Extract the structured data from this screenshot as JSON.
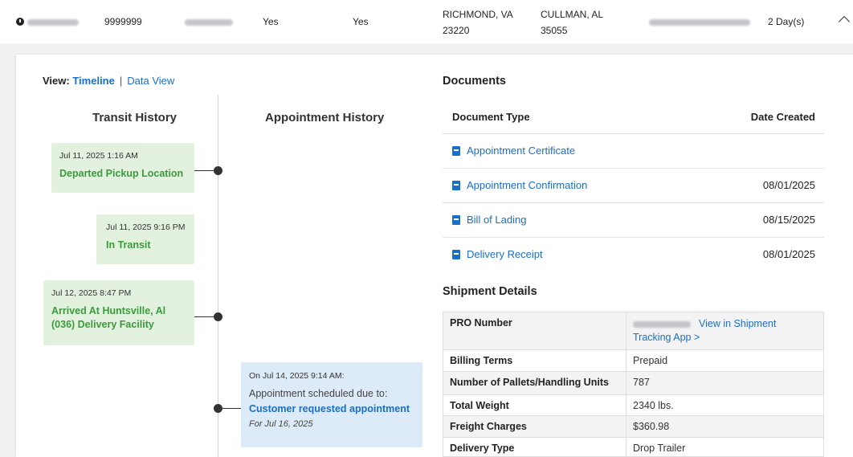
{
  "summary": {
    "quantity": "9999999",
    "col_yes_1": "Yes",
    "col_yes_2": "Yes",
    "origin_city": "RICHMOND, VA",
    "origin_zip": "23220",
    "dest_city": "CULLMAN, AL",
    "dest_zip": "35055",
    "transit_time": "2 Day(s)"
  },
  "view": {
    "label": "View:",
    "timeline": "Timeline",
    "separator": "|",
    "data_view": "Data View"
  },
  "transit_history": {
    "title": "Transit History",
    "events": [
      {
        "timestamp": "Jul 11, 2025 1:16 AM",
        "status": "Departed Pickup Location"
      },
      {
        "timestamp": "Jul 11, 2025 9:16 PM",
        "status": "In Transit"
      },
      {
        "timestamp": "Jul 12, 2025 8:47 PM",
        "status": "Arrived At Huntsville, Al (036) Delivery Facility"
      }
    ]
  },
  "appointment_history": {
    "title": "Appointment History",
    "entry": {
      "timestamp": "On Jul 14, 2025 9:14 AM:",
      "text": "Appointment scheduled due to:",
      "reason": "Customer requested appointment",
      "for_date": "For Jul 16, 2025"
    }
  },
  "documents": {
    "title": "Documents",
    "columns": [
      "Document Type",
      "Date Created"
    ],
    "rows": [
      {
        "name": "Appointment Certificate",
        "date": ""
      },
      {
        "name": "Appointment Confirmation",
        "date": "08/01/2025"
      },
      {
        "name": "Bill of Lading",
        "date": "08/15/2025"
      },
      {
        "name": "Delivery Receipt",
        "date": "08/01/2025"
      }
    ]
  },
  "shipment_details": {
    "title": "Shipment Details",
    "pro_number_label": "PRO Number",
    "pro_link": "View in Shipment Tracking App >",
    "rows": [
      {
        "label": "Billing Terms",
        "value": "Prepaid"
      },
      {
        "label": "Number of Pallets/Handling Units",
        "value": "787"
      },
      {
        "label": "Total Weight",
        "value": "2340 lbs."
      },
      {
        "label": "Freight Charges",
        "value": "$360.98"
      },
      {
        "label": "Delivery Type",
        "value": "Drop Trailer"
      }
    ]
  },
  "colors": {
    "link": "#1a6fc9",
    "transit_bg": "#e2f2df",
    "transit_text": "#3b9a3b",
    "appt_bg": "#ddeaf7"
  }
}
